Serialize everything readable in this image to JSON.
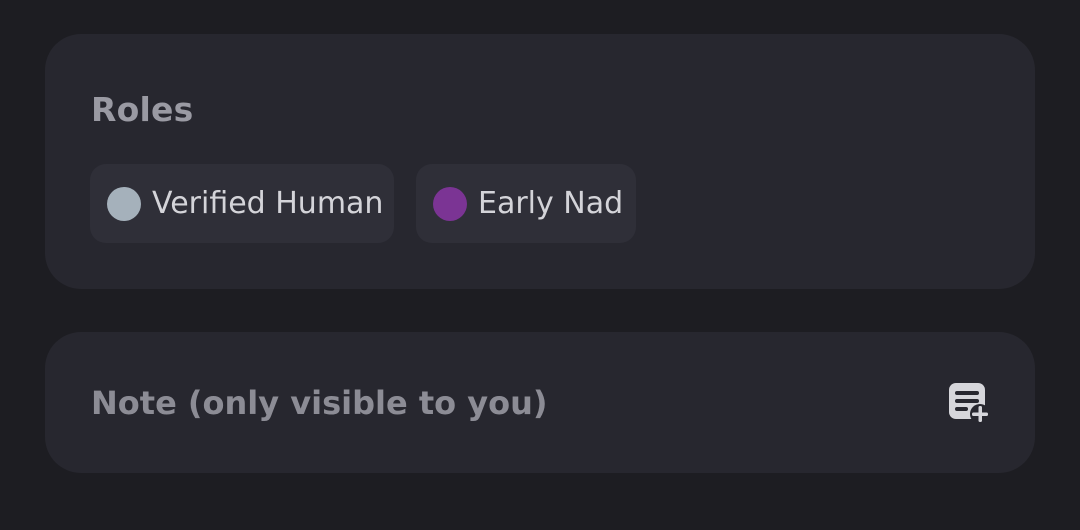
{
  "roles_section": {
    "title": "Roles",
    "roles": [
      {
        "label": "Verified Human",
        "color": "#a5b1bb"
      },
      {
        "label": "Early Nad",
        "color": "#7b3494"
      }
    ]
  },
  "note_section": {
    "placeholder": "Note (only visible to you)",
    "icon": "add-note-icon"
  },
  "colors": {
    "background": "#1d1d22",
    "card": "#27272f",
    "pill": "#2f2f38",
    "muted_text": "#9a9aa3",
    "role_text": "#d4d4d9"
  }
}
